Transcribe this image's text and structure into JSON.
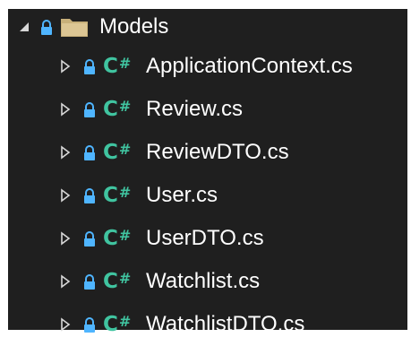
{
  "colors": {
    "background": "#1f1f1f",
    "text": "#ffffff",
    "lock": "#4fb5ff",
    "folder": "#c8b07a",
    "csharp": "#40c4a0",
    "expander": "#d8d8d8"
  },
  "folder": {
    "name": "Models",
    "expanded": true,
    "icons": [
      "expanded-triangle-icon",
      "lock-icon",
      "folder-icon"
    ]
  },
  "files": [
    {
      "name": "ApplicationContext.cs",
      "type_label": "C",
      "type_suffix": "#"
    },
    {
      "name": "Review.cs",
      "type_label": "C",
      "type_suffix": "#"
    },
    {
      "name": "ReviewDTO.cs",
      "type_label": "C",
      "type_suffix": "#"
    },
    {
      "name": "User.cs",
      "type_label": "C",
      "type_suffix": "#"
    },
    {
      "name": "UserDTO.cs",
      "type_label": "C",
      "type_suffix": "#"
    },
    {
      "name": "Watchlist.cs",
      "type_label": "C",
      "type_suffix": "#"
    },
    {
      "name": "WatchlistDTO.cs",
      "type_label": "C",
      "type_suffix": "#"
    }
  ]
}
